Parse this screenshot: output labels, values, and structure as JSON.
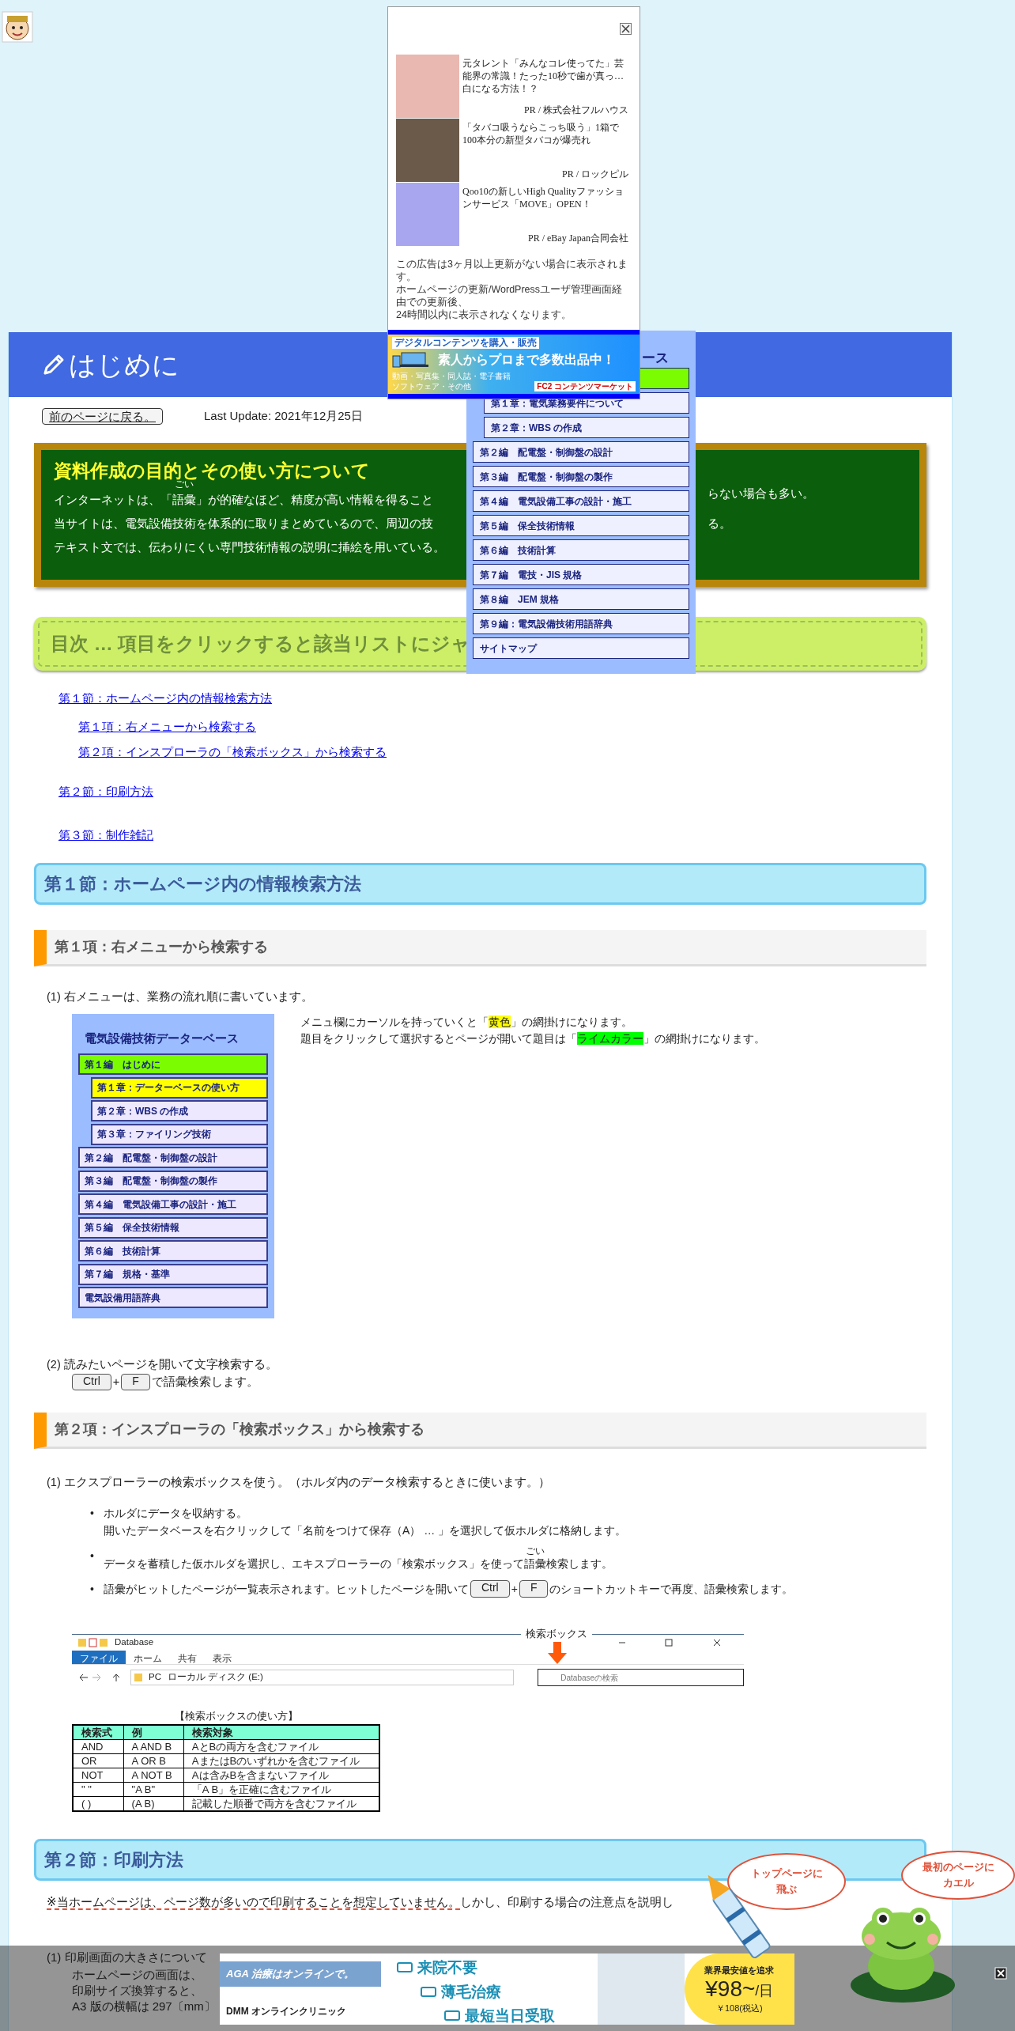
{
  "ad_popup": {
    "items": [
      {
        "text": "元タレント「みんなコレ使ってた」芸能界の常識！たった10秒で歯が真っ…白になる方法！？",
        "source": "PR / 株式会社フルハウス"
      },
      {
        "text": "「タバコ吸うならこっち吸う」1箱で100本分の新型タバコが爆売れ",
        "source": "PR / ロックピル"
      },
      {
        "text": "Qoo10の新しいHigh Qualityファッションサービス「MOVE」OPEN！",
        "source": "PR / eBay Japan合同会社"
      }
    ],
    "note": [
      "この広告は3ヶ月以上更新がない場合に表示されます。",
      "ホームページの更新/WordPressユーザ管理画面経由での更新後、",
      "24時間以内に表示されなくなります。"
    ]
  },
  "top_banner": {
    "tag": "デジタルコンテンツを購入・販売",
    "headline": "素人からプロまで多数出品中！",
    "lines": [
      "動画・写真集・同人誌・電子書籍",
      "ソフトウェア・その他"
    ],
    "brand": "FC2 コンテンツマーケット"
  },
  "header": {
    "title": "はじめに"
  },
  "back_button": "前のページに戻る。",
  "last_update": "Last Update: 2021年12月25日",
  "board": {
    "title": "資料作成の目的とその使い方について",
    "lines": [
      {
        "left": [
          "インターネットは、「",
          {
            "kind": "ruby",
            "base": "語彙",
            "ruby": "ごい"
          },
          "」が的確なほど、精度が高い情報を得ること"
        ],
        "right": "らない場合も多い。"
      },
      {
        "left": [
          "当サイトは、電気設備技術を体系的に取りまとめているので、周辺の技"
        ],
        "right": "る。"
      },
      {
        "left": [
          "テキスト文では、伝わりにくい専門技術情報の説明に挿絵を用いている。"
        ]
      }
    ]
  },
  "side_menu": {
    "header": "ース",
    "items": [
      {
        "kind": "part",
        "selected": true
      },
      {
        "kind": "chapter",
        "label": "第１章：電気業務要件について",
        "selected": false
      },
      {
        "kind": "chapter",
        "label": "第２章：WBS の作成",
        "selected": false
      },
      {
        "kind": "part",
        "label": "第２編　配電盤・制御盤の設計",
        "selected": false
      },
      {
        "kind": "part",
        "label": "第３編　配電盤・制御盤の製作",
        "selected": false
      },
      {
        "kind": "part",
        "label": "第４編　電気設備工事の設計・施工",
        "selected": false
      },
      {
        "kind": "part",
        "label": "第５編　保全技術情報",
        "selected": false
      },
      {
        "kind": "part",
        "label": "第６編　技術計算",
        "selected": false
      },
      {
        "kind": "part",
        "label": "第７編　電技・JIS 規格",
        "selected": false
      },
      {
        "kind": "part",
        "label": "第８編　JEM 規格",
        "selected": false
      },
      {
        "kind": "part",
        "label": "第９編：電気設備技術用語辞典",
        "selected": false
      },
      {
        "kind": "part",
        "label": "サイトマップ",
        "selected": false
      }
    ]
  },
  "toc": {
    "heading": "目次 … 項目をクリックすると該当リストにジャ",
    "links": [
      {
        "label": "第１節：ホームページ内の情報検索方法",
        "children": [
          {
            "label": "第１項：右メニューから検索する"
          },
          {
            "label": "第２項：インスプローラの「検索ボックス」から検索する"
          }
        ]
      },
      {
        "label": "第２節：印刷方法"
      },
      {
        "label": "第３節：制作雑記"
      }
    ]
  },
  "section1": {
    "title": "第１節：ホームページ内の情報検索方法",
    "item1": {
      "title": "第１項：右メニューから検索する",
      "intro": "(1) 右メニューは、業務の流れ順に書いています。",
      "menu_shot": {
        "title": "電気設備技術データーベース",
        "items": [
          {
            "kind": "part",
            "label": "第１編　はじめに",
            "color": "#7cfc00"
          },
          {
            "kind": "chapter",
            "label": "第１章：データーベースの使い方",
            "color": "#ffff00"
          },
          {
            "kind": "chapter",
            "label": "第２章：WBS の作成"
          },
          {
            "kind": "chapter",
            "label": "第３章：ファイリング技術"
          },
          {
            "kind": "part",
            "label": "第２編　配電盤・制御盤の設計"
          },
          {
            "kind": "part",
            "label": "第３編　配電盤・制御盤の製作"
          },
          {
            "kind": "part",
            "label": "第４編　電気設備工事の設計・施工"
          },
          {
            "kind": "part",
            "label": "第５編　保全技術情報"
          },
          {
            "kind": "part",
            "label": "第６編　技術計算"
          },
          {
            "kind": "part",
            "label": "第７編　規格・基準"
          },
          {
            "kind": "part",
            "label": "電気設備用語辞典"
          }
        ]
      },
      "notes": [
        [
          "メニュ欄にカーソルを持っていくと「",
          {
            "kind": "highlight",
            "text": "黄色",
            "color": "#ffff00"
          },
          "」の網掛けになります。"
        ],
        [
          "題目をクリックして選択するとページが開いて題目は「",
          {
            "kind": "highlight",
            "text": "ライムカラー",
            "color": "#00ff00"
          },
          "」の網掛けになります。"
        ]
      ],
      "step2": "(2) 読みたいページを開いて文字検索する。",
      "step2_keys": [
        {
          "kind": "key",
          "text": "Ctrl"
        },
        " + ",
        {
          "kind": "key",
          "text": "F"
        },
        "で語彙検索します。"
      ]
    },
    "item2": {
      "title": "第２項：インスプローラの「検索ボックス」から検索する",
      "intro": "(1) エクスプローラーの検索ボックスを使う。（ホルダ内のデータ検索するときに使います。）",
      "bullets": [
        {
          "marker": "•",
          "lines": [
            [
              "ホルダにデータを収納する。"
            ],
            [
              "開いたデータベースを右クリックして「名前をつけて保存（A） … 」を選択して仮ホルダに格納します。"
            ]
          ]
        },
        {
          "marker": "•",
          "lines": [
            [
              "データを蓄積した仮ホルダを選択し、エキスプローラーの「検索ボックス」を使って",
              {
                "kind": "ruby",
                "base": "語彙",
                "ruby": "ごい"
              },
              "検索します。"
            ]
          ]
        },
        {
          "marker": "•",
          "lines": [
            [
              "語彙がヒットしたページが一覧表示されます。ヒットしたページを開いて",
              {
                "kind": "key",
                "text": "Ctrl"
              },
              " + ",
              {
                "kind": "key",
                "text": "F"
              },
              " のショートカットキーで再度、語彙検索します。"
            ]
          ]
        }
      ],
      "explorer": {
        "title": "Database",
        "tabs": [
          {
            "label": "ファイル",
            "selected": true
          },
          {
            "label": "ホーム",
            "selected": false
          },
          {
            "label": "共有",
            "selected": false
          },
          {
            "label": "表示",
            "selected": false
          }
        ],
        "path": [
          "PC",
          "ローカル ディスク (E:)"
        ],
        "search_placeholder": "Databaseの検索",
        "callout": "検索ボックス"
      },
      "table": {
        "caption": "【検索ボックスの使い方】",
        "columns": [
          "検索式",
          "例",
          "検索対象"
        ],
        "rows": [
          [
            "AND",
            "A AND B",
            "AとBの両方を含むファイル"
          ],
          [
            "OR",
            "A OR B",
            "AまたはBのいずれかを含むファイル"
          ],
          [
            "NOT",
            "A NOT B",
            "Aは含みBを含まないファイル"
          ],
          [
            "\" \"",
            "\"A B\"",
            "「A B」を正確に含むファイル"
          ],
          [
            "( )",
            "(A B)",
            "記載した順番で両方を含むファイル"
          ]
        ]
      }
    }
  },
  "section2": {
    "title": "第２節：印刷方法",
    "note": [
      {
        "kind": "underline",
        "text": "※当ホームページは、ページ数が多いので印刷することを想定していません。",
        "marked": true
      },
      "しかし、印刷する場合の注意点を説明し"
    ],
    "item": "(1) 印刷画面の大きさについて",
    "lines": [
      "ホームページの画面は、",
      "印刷サイズ換算すると、",
      "A3 版の横幅は 297〔mm〕"
    ]
  },
  "mascots": {
    "rocket_bubble": [
      "トップページに",
      "飛ぶ"
    ],
    "frog_bubble": [
      "最初のページに",
      "カエル"
    ]
  },
  "bottom_ad": {
    "tag": "AGA 治療はオンラインで。",
    "brand": "DMM オンラインクリニック",
    "points": [
      "来院不要",
      "薄毛治療",
      "最短当日受取"
    ],
    "price_note": "業界最安値を追求",
    "price": "¥98~",
    "per": "/日",
    "tax": "￥108(税込)"
  }
}
